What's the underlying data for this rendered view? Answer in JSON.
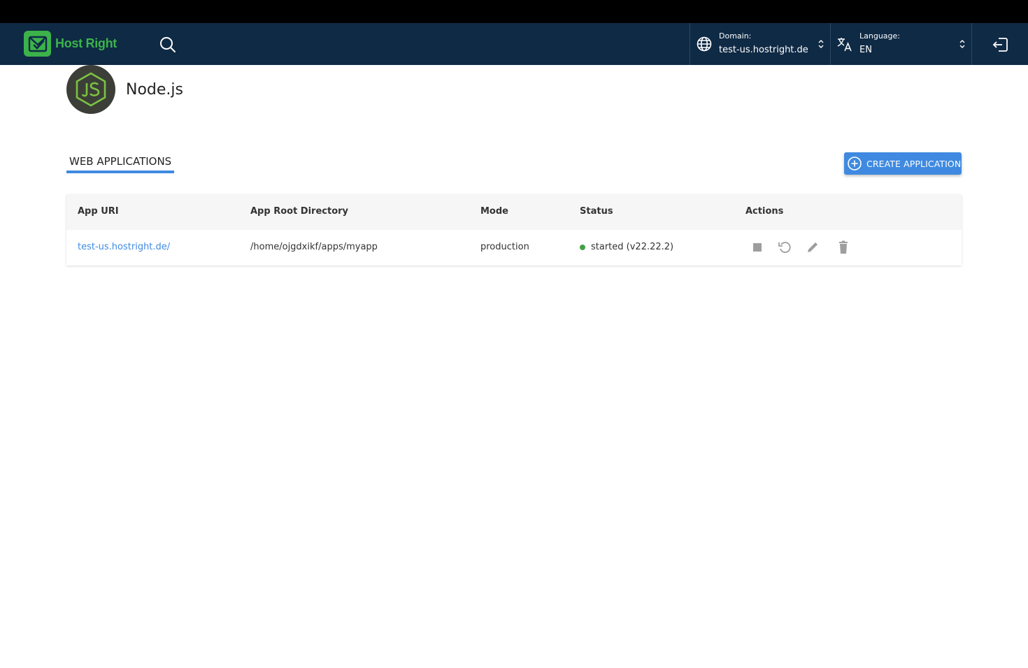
{
  "brand": {
    "name": "Host Right",
    "logo_color": "#3bb34a"
  },
  "navbar": {
    "background": "#0f2a45",
    "search_icon": "search-icon",
    "domain": {
      "label": "Domain:",
      "value": "test-us.hostright.de"
    },
    "language": {
      "label": "Language:",
      "value": "EN"
    },
    "logout_icon": "logout-icon"
  },
  "app": {
    "title": "Node.js",
    "icon": "nodejs-icon"
  },
  "tabs": [
    {
      "label": "WEB APPLICATIONS",
      "active": true
    }
  ],
  "create_button": {
    "label": "CREATE APPLICATION",
    "color": "#3f8ae0"
  },
  "table": {
    "headers": [
      "App URI",
      "App Root Directory",
      "Mode",
      "Status",
      "Actions"
    ],
    "rows": [
      {
        "uri": "test-us.hostright.de/",
        "root": "/home/ojgdxikf/apps/myapp",
        "mode": "production",
        "status": "started (v22.22.2)",
        "status_color": "#43a047",
        "actions": [
          "stop-icon",
          "restart-icon",
          "edit-icon",
          "delete-icon"
        ]
      }
    ]
  }
}
